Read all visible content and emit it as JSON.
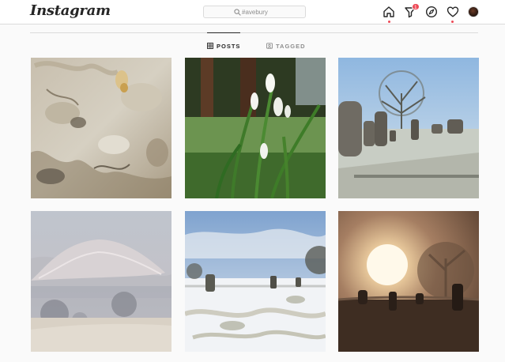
{
  "header": {
    "logo_text": "Instagram",
    "search": {
      "value": "#avebury"
    },
    "notification_count": "1"
  },
  "tabs": [
    {
      "label": "POSTS",
      "active": true
    },
    {
      "label": "TAGGED",
      "active": false
    }
  ],
  "posts": [
    {
      "subject": "chalk stone with lichen"
    },
    {
      "subject": "snowdrops"
    },
    {
      "subject": "frosty standing stones"
    },
    {
      "subject": "misty Silbury Hill"
    },
    {
      "subject": "snowy stone circle"
    },
    {
      "subject": "foggy sunrise over stones"
    }
  ],
  "colors": {
    "accent": "#ed4956",
    "border": "#dbdbdb",
    "text": "#262626",
    "muted": "#8e8e8e"
  }
}
